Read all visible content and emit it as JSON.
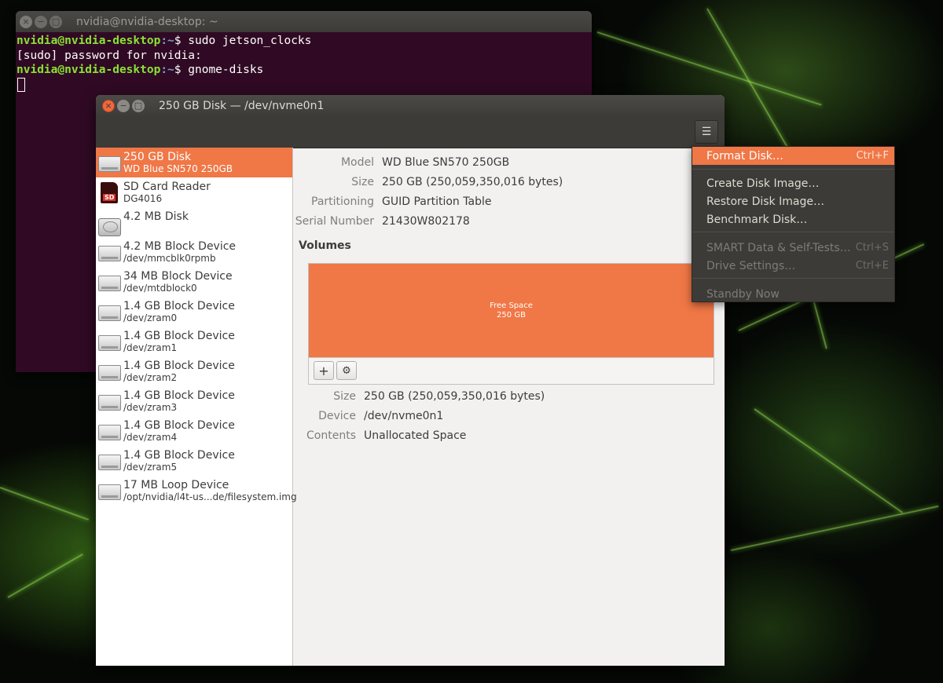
{
  "terminal": {
    "title": "nvidia@nvidia-desktop: ~",
    "lines": [
      {
        "user": "nvidia@nvidia-desktop",
        "path": ":~",
        "cmd": "$ sudo jetson_clocks"
      },
      {
        "text": "[sudo] password for nvidia:"
      },
      {
        "user": "nvidia@nvidia-desktop",
        "path": ":~",
        "cmd": "$ gnome-disks"
      }
    ]
  },
  "disks": {
    "title": "250 GB Disk — /dev/nvme0n1",
    "menu_icon": "hamburger-icon",
    "devices": [
      {
        "name": "250 GB Disk",
        "sub": "WD Blue SN570 250GB",
        "icon": "ssd-icon",
        "selected": true
      },
      {
        "name": "SD Card Reader",
        "sub": "DG4016",
        "icon": "sd-card-icon"
      },
      {
        "name": "4.2 MB Disk",
        "sub": "",
        "icon": "hard-disk-icon"
      },
      {
        "name": "4.2 MB Block Device",
        "sub": "/dev/mmcblk0rpmb",
        "icon": "drive-icon"
      },
      {
        "name": "34 MB Block Device",
        "sub": "/dev/mtdblock0",
        "icon": "drive-icon"
      },
      {
        "name": "1.4 GB Block Device",
        "sub": "/dev/zram0",
        "icon": "drive-icon"
      },
      {
        "name": "1.4 GB Block Device",
        "sub": "/dev/zram1",
        "icon": "drive-icon"
      },
      {
        "name": "1.4 GB Block Device",
        "sub": "/dev/zram2",
        "icon": "drive-icon"
      },
      {
        "name": "1.4 GB Block Device",
        "sub": "/dev/zram3",
        "icon": "drive-icon"
      },
      {
        "name": "1.4 GB Block Device",
        "sub": "/dev/zram4",
        "icon": "drive-icon"
      },
      {
        "name": "1.4 GB Block Device",
        "sub": "/dev/zram5",
        "icon": "drive-icon"
      },
      {
        "name": "17 MB Loop Device",
        "sub": "/opt/nvidia/l4t-us...de/filesystem.img",
        "icon": "drive-icon"
      }
    ],
    "details": {
      "model_label": "Model",
      "model": "WD Blue SN570 250GB",
      "size_label": "Size",
      "size": "250 GB (250,059,350,016 bytes)",
      "partitioning_label": "Partitioning",
      "partitioning": "GUID Partition Table",
      "serial_label": "Serial Number",
      "serial": "21430W802178"
    },
    "volumes_heading": "Volumes",
    "volume": {
      "line1": "Free Space",
      "line2": "250 GB"
    },
    "toolbar": {
      "add": "+",
      "settings_icon": "gears-icon"
    },
    "volume_details": {
      "size_label": "Size",
      "size": "250 GB (250,059,350,016 bytes)",
      "device_label": "Device",
      "device": "/dev/nvme0n1",
      "contents_label": "Contents",
      "contents": "Unallocated Space"
    }
  },
  "menu": {
    "items": [
      {
        "label": "Format Disk…",
        "accel": "Ctrl+F",
        "state": "highlighted"
      },
      {
        "label": "Create Disk Image…",
        "accel": "",
        "state": "normal"
      },
      {
        "label": "Restore Disk Image…",
        "accel": "",
        "state": "normal"
      },
      {
        "label": "Benchmark Disk…",
        "accel": "",
        "state": "normal"
      },
      {
        "label": "SMART Data & Self-Tests…",
        "accel": "Ctrl+S",
        "state": "disabled"
      },
      {
        "label": "Drive Settings…",
        "accel": "Ctrl+E",
        "state": "disabled"
      },
      {
        "label": "Standby Now",
        "accel": "",
        "state": "disabled"
      }
    ]
  },
  "colors": {
    "accent": "#f07746",
    "terminal_bg": "#300a24",
    "headerbar": "#3c3b37"
  }
}
